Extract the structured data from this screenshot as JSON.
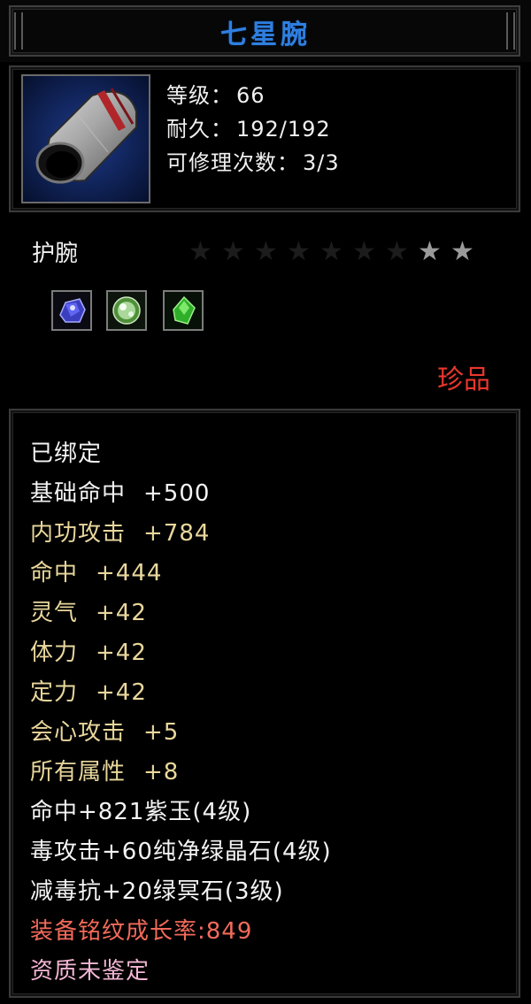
{
  "item": {
    "title": "七星腕",
    "level_label": "等级：",
    "level_value": "66",
    "durability_label": "耐久：",
    "durability_value": "192/192",
    "repair_label": "可修理次数：",
    "repair_value": "3/3",
    "type": "护腕",
    "rarity": "珍品",
    "stars": {
      "total": 9,
      "lit": 2
    },
    "gems": [
      "sapphire-gem-icon",
      "white-green-gem-icon",
      "green-gem-icon"
    ]
  },
  "attributes": {
    "bound": "已绑定",
    "base_hit_label": "基础命中",
    "base_hit_value": "+500",
    "internal_attack_label": "内功攻击",
    "internal_attack_value": "+784",
    "hit_label": "命中",
    "hit_value": "+444",
    "spirit_label": "灵气",
    "spirit_value": "+42",
    "stamina_label": "体力",
    "stamina_value": "+42",
    "focus_label": "定力",
    "focus_value": "+42",
    "crit_label": "会心攻击",
    "crit_value": "+5",
    "all_attr_label": "所有属性",
    "all_attr_value": "+8",
    "gem_line_1": "命中+821紫玉(4级)",
    "gem_line_2": "毒攻击+60纯净绿晶石(4级)",
    "gem_line_3": "减毒抗+20绿冥石(3级)",
    "inscription_growth": "装备铭纹成长率:849",
    "aptitude": "资质未鉴定"
  },
  "colors": {
    "title": "#2f7fe0",
    "attribute": "#e9d79c",
    "rarity": "#e8372c",
    "inscription": "#f26a5a",
    "aptitude": "#f3b6d4"
  }
}
